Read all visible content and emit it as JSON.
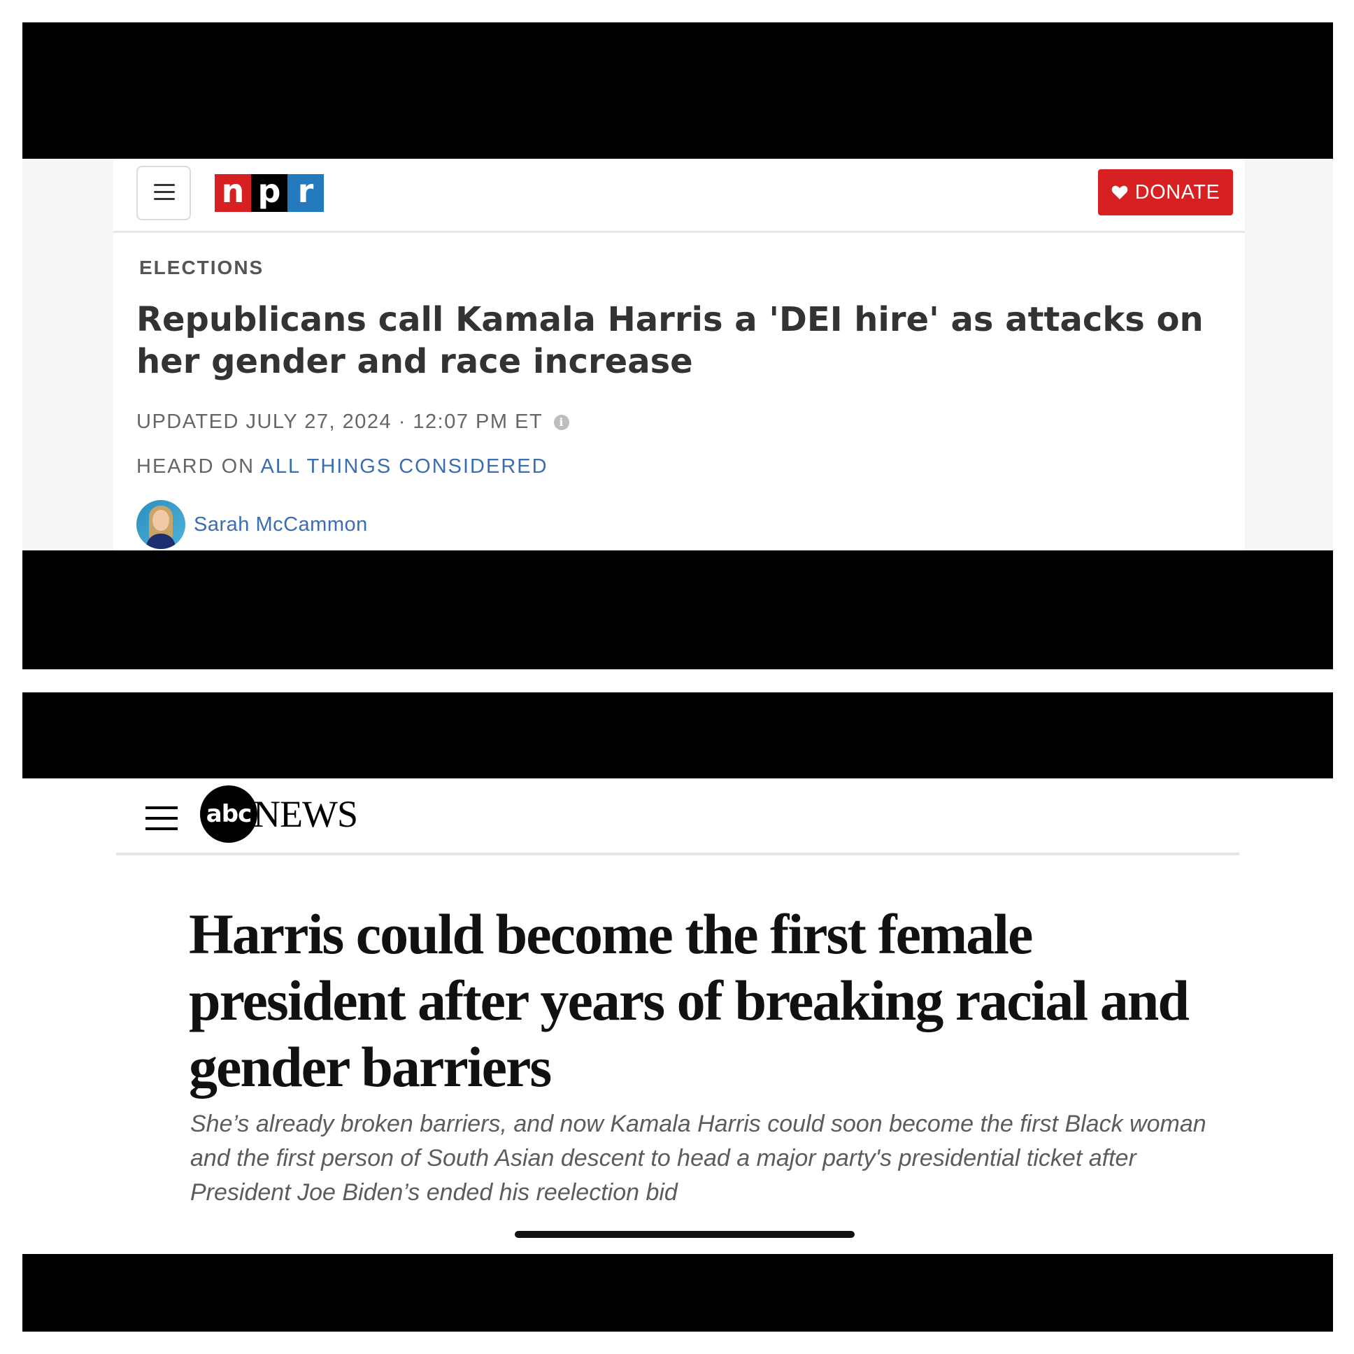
{
  "npr": {
    "logo": {
      "n": "n",
      "p": "p",
      "r": "r"
    },
    "donate_label": "DONATE",
    "section": "ELECTIONS",
    "headline": "Republicans call Kamala Harris a 'DEI hire' as attacks on her gender and race increase",
    "updated": "UPDATED JULY 27, 2024 · 12:07 PM ET",
    "heard_on_prefix": "HEARD ON",
    "program": "ALL THINGS CONSIDERED",
    "author": "Sarah McCammon",
    "colors": {
      "red": "#d62021",
      "blue": "#237bbd",
      "link": "#3b6db3"
    },
    "icons": [
      "menu-icon",
      "heart-icon",
      "info-icon"
    ]
  },
  "abc": {
    "logo_circle": "abc",
    "logo_news": "NEWS",
    "headline": "Harris could become the first female president after years of breaking racial and gender barriers",
    "subheadline": "She’s already broken barriers, and now Kamala Harris could soon become the first Black woman and the first person of South Asian descent to head a major party's presidential ticket after President Joe Biden’s ended his reelection bid",
    "icons": [
      "menu-icon"
    ]
  }
}
